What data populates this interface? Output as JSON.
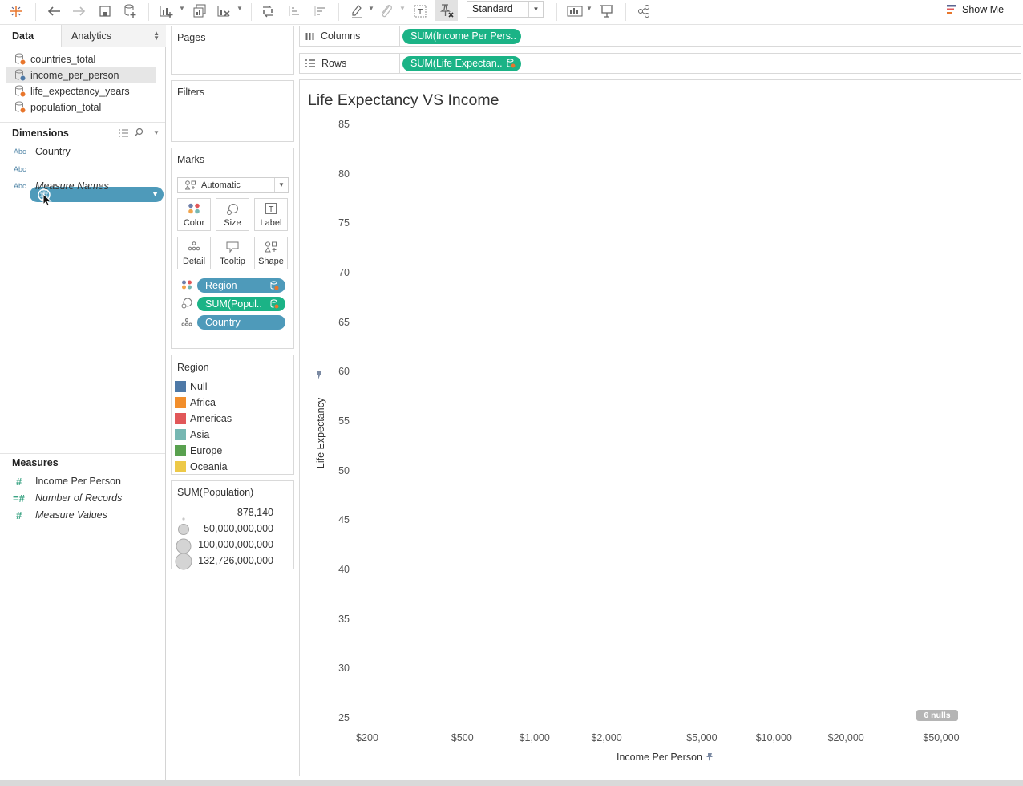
{
  "toolbar": {
    "view_mode": "Standard",
    "show_me": "Show Me"
  },
  "data_pane": {
    "tabs": {
      "data": "Data",
      "analytics": "Analytics"
    },
    "data_sources": [
      {
        "label": "countries_total"
      },
      {
        "label": "income_per_person"
      },
      {
        "label": "life_expectancy_years"
      },
      {
        "label": "population_total"
      }
    ],
    "dimensions_title": "Dimensions",
    "dimensions": [
      {
        "type": "Abc",
        "label": "Country"
      },
      {
        "type": "Abc",
        "label": ""
      },
      {
        "type": "Abc",
        "label": "Measure Names"
      }
    ],
    "measures_title": "Measures",
    "measures": [
      {
        "type": "#",
        "label": "Income Per Person"
      },
      {
        "type": "=#",
        "label": "Number of Records"
      },
      {
        "type": "#",
        "label": "Measure Values"
      }
    ]
  },
  "cards": {
    "pages": "Pages",
    "filters": "Filters",
    "marks": {
      "title": "Marks",
      "type": "Automatic",
      "buttons": [
        "Color",
        "Size",
        "Label",
        "Detail",
        "Tooltip",
        "Shape"
      ],
      "pills": [
        {
          "label": "Region",
          "encoding": "color"
        },
        {
          "label": "SUM(Popul..",
          "encoding": "size"
        },
        {
          "label": "Country",
          "encoding": "detail"
        }
      ]
    },
    "region_legend": {
      "title": "Region",
      "items": [
        {
          "label": "Null",
          "color": "#4e79a7"
        },
        {
          "label": "Africa",
          "color": "#f28e2b"
        },
        {
          "label": "Americas",
          "color": "#e15759"
        },
        {
          "label": "Asia",
          "color": "#76b7b2"
        },
        {
          "label": "Europe",
          "color": "#59a14f"
        },
        {
          "label": "Oceania",
          "color": "#edc948"
        }
      ]
    },
    "size_legend": {
      "title": "SUM(Population)",
      "items": [
        "878,140",
        "50,000,000,000",
        "100,000,000,000",
        "132,726,000,000"
      ]
    }
  },
  "shelves": {
    "columns_label": "Columns",
    "columns_pill": "SUM(Income Per Pers..",
    "rows_label": "Rows",
    "rows_pill": "SUM(Life Expectan.."
  },
  "view": {
    "title": "Life Expectancy VS Income",
    "nulls_badge": "6 nulls"
  },
  "chart_data": {
    "type": "scatter",
    "title": "Life Expectancy VS Income",
    "xlabel": "Income Per Person",
    "ylabel": "Life Expectancy",
    "x_scale": "log",
    "x_ticks": [
      "$200",
      "$500",
      "$1,000",
      "$2,000",
      "$5,000",
      "$10,000",
      "$20,000",
      "$50,000"
    ],
    "x_tick_values": [
      200,
      500,
      1000,
      2000,
      5000,
      10000,
      20000,
      50000
    ],
    "y_ticks": [
      85,
      80,
      75,
      70,
      65,
      60,
      55,
      50,
      45,
      40,
      35,
      30,
      25
    ],
    "ylim": [
      25,
      85
    ],
    "series": [],
    "grid": false
  }
}
